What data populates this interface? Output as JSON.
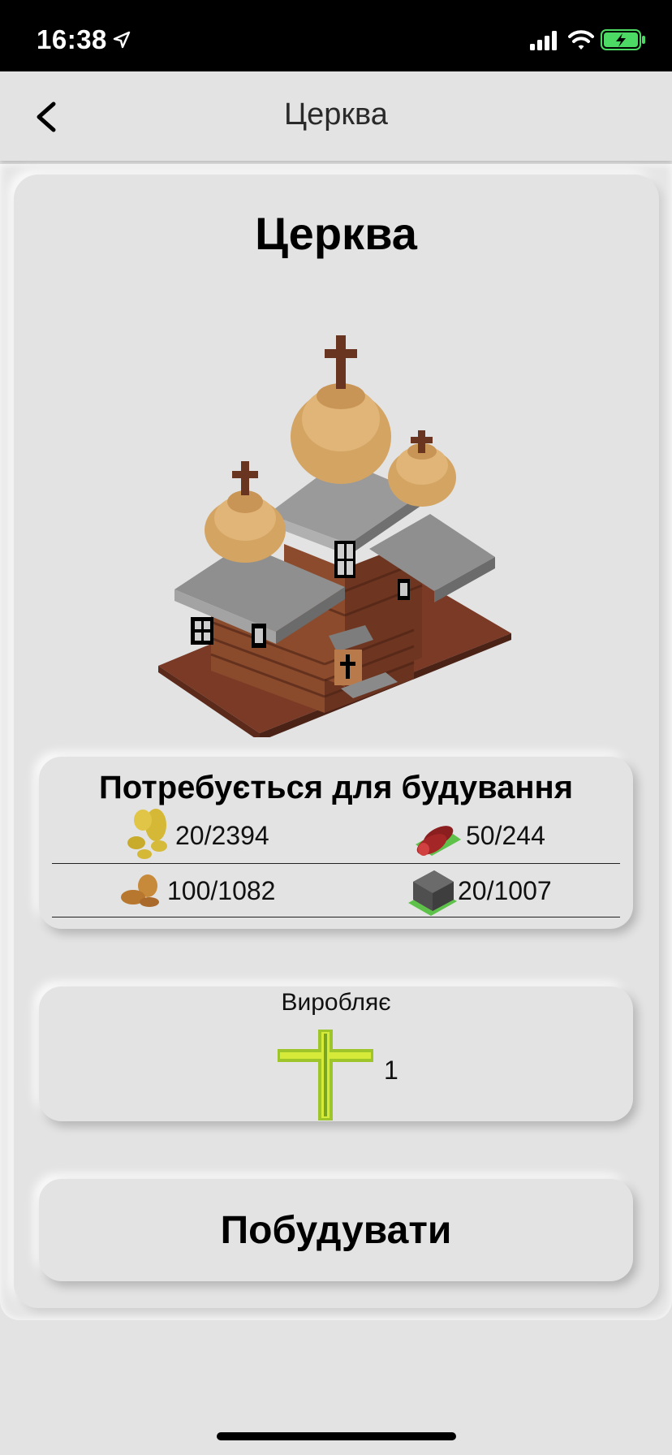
{
  "status_bar": {
    "time": "16:38",
    "icons": [
      "location-arrow-icon",
      "signal-icon",
      "wifi-icon",
      "battery-charging-icon"
    ],
    "battery_color": "#4cd964"
  },
  "nav": {
    "title": "Церква",
    "back_icon": "chevron-left-icon"
  },
  "building": {
    "title": "Церква",
    "image": "church-building-image"
  },
  "requirements": {
    "title": "Потребується для будування",
    "items": [
      {
        "icon": "gold-coins-icon",
        "value": "20/2394"
      },
      {
        "icon": "logs-icon",
        "value": "50/244"
      },
      {
        "icon": "bread-icon",
        "value": "100/1082"
      },
      {
        "icon": "stone-icon",
        "value": "20/1007"
      }
    ]
  },
  "produces": {
    "label": "Виробляє",
    "icon": "cross-icon",
    "value": "1"
  },
  "build_button": {
    "label": "Побудувати"
  },
  "colors": {
    "background": "#e3e3e3",
    "status_bar": "#000000",
    "cross_green": "#9ec62a"
  }
}
